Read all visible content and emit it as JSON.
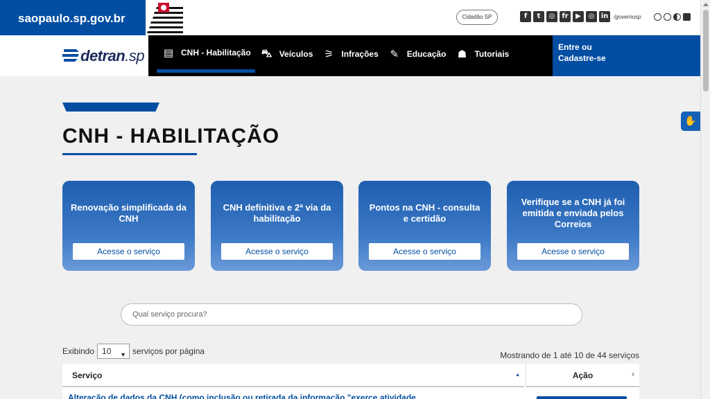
{
  "gov": {
    "brand": "saopaulo.sp.gov.br",
    "cidadao_label": "Cidadão SP",
    "social_icons": [
      "f",
      "t",
      "◎",
      "fr",
      "▶",
      "◎",
      "in"
    ],
    "handle": "/governosp",
    "a11y_icons": [
      "A-",
      "A+",
      "contrast",
      "square"
    ]
  },
  "nav": {
    "logo_bold": "detran",
    "logo_thin": ".sp",
    "items": [
      {
        "label": "CNH - Habilitação",
        "icon": "license-icon",
        "glyph": "▤"
      },
      {
        "label": "Veículos",
        "icon": "car-icon",
        "glyph": "⛍"
      },
      {
        "label": "Infrações",
        "icon": "traffic-light-icon",
        "glyph": "⚞"
      },
      {
        "label": "Educação",
        "icon": "pencil-icon",
        "glyph": "✎"
      },
      {
        "label": "Tutoriais",
        "icon": "tutorial-icon",
        "glyph": "☗"
      }
    ],
    "login_line1": "Entre ou",
    "login_line2": "Cadastre-se"
  },
  "page": {
    "title": "CNH - HABILITAÇÃO"
  },
  "cards": [
    {
      "title": "Renovação simplificada da CNH",
      "button": "Acesse o serviço"
    },
    {
      "title": "CNH definitiva e 2ª via da habilitação",
      "button": "Acesse o serviço"
    },
    {
      "title": "Pontos na CNH - consulta e certidão",
      "button": "Acesse o serviço"
    },
    {
      "title": "Verifique se a CNH já foi emitida e enviada pelos Correios",
      "button": "Acesse o serviço"
    }
  ],
  "search": {
    "placeholder": "Qual serviço procura?"
  },
  "table": {
    "exibindo_label": "Exibindo",
    "page_size": "10",
    "page_size_suffix": "serviços por página",
    "mostrando": "Mostrando de 1 até 10 de 44 serviços",
    "col_servico": "Serviço",
    "col_acao": "Ação",
    "first_row": "Alteração de dados da CNH (como inclusão ou retirada da informação \"exerce atividade"
  },
  "colors": {
    "primary": "#034ea2",
    "nav_bg": "#000000"
  }
}
